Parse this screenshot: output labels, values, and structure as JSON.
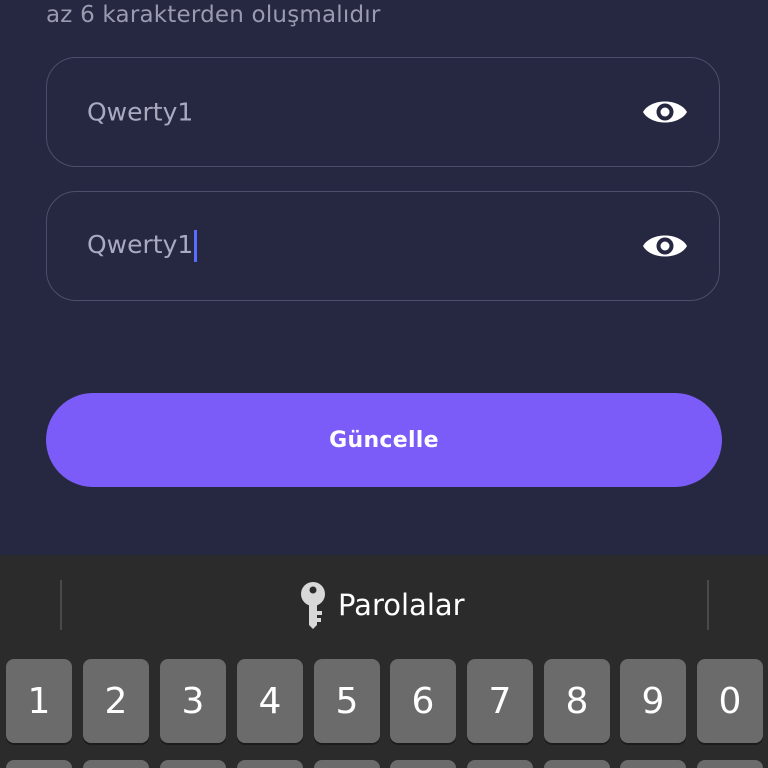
{
  "form": {
    "hint_text": "az 6 karakterden oluşmalıdır",
    "password_value": "Qwerty1",
    "confirm_value": "Qwerty1",
    "submit_label": "Güncelle"
  },
  "keyboard": {
    "suggestion_label": "Parolalar",
    "number_keys": [
      "1",
      "2",
      "3",
      "4",
      "5",
      "6",
      "7",
      "8",
      "9",
      "0"
    ]
  },
  "colors": {
    "background": "#262740",
    "accent": "#7b5cf8",
    "caret": "#5a6cff",
    "keyboard_bg": "#2b2b2b",
    "key_bg": "#6b6b6b"
  },
  "icons": {
    "visibility_toggle": "eye-icon",
    "suggestion": "key-icon"
  }
}
